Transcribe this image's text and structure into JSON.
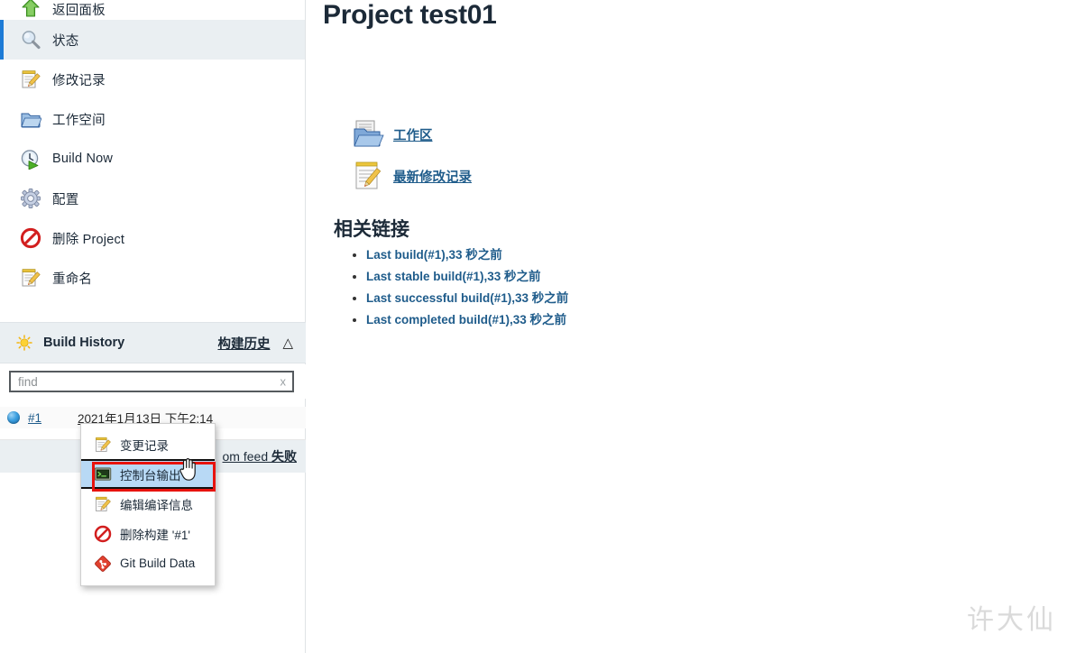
{
  "sidebar": {
    "tasks": [
      {
        "label": "返回面板",
        "icon": "up-arrow-icon",
        "active": false,
        "partial": true
      },
      {
        "label": "状态",
        "icon": "magnifier-icon",
        "active": true,
        "partial": false
      },
      {
        "label": "修改记录",
        "icon": "notepad-pencil-icon",
        "active": false,
        "partial": false
      },
      {
        "label": "工作空间",
        "icon": "folder-icon",
        "active": false,
        "partial": false
      },
      {
        "label": "Build Now",
        "icon": "build-clock-icon",
        "active": false,
        "partial": false
      },
      {
        "label": "配置",
        "icon": "gear-icon",
        "active": false,
        "partial": false
      },
      {
        "label": "删除 Project",
        "icon": "delete-forbidden-icon",
        "active": false,
        "partial": false
      },
      {
        "label": "重命名",
        "icon": "notepad-pencil-icon",
        "active": false,
        "partial": false
      }
    ],
    "build_history": {
      "title": "Build History",
      "link_label": "构建历史",
      "collapse_icon": "chevron-up-icon",
      "sun_icon": "weather-sun-icon",
      "find": {
        "value": "",
        "placeholder": "find",
        "clear_label": "x"
      },
      "rows": [
        {
          "status": "blue-ball-icon",
          "number": "#1",
          "date": "2021年1月13日 下午2:14"
        }
      ],
      "feed": {
        "prefix": "om feed ",
        "status": "失败"
      }
    }
  },
  "main": {
    "page_title": "Project test01",
    "quick_links": [
      {
        "label": "工作区",
        "icon": "workspace-folder-icon"
      },
      {
        "label": "最新修改记录",
        "icon": "changes-notepad-icon"
      }
    ],
    "related_heading": "相关链接",
    "related_links": [
      "Last build(#1),33 秒之前",
      "Last stable build(#1),33 秒之前",
      "Last successful build(#1),33 秒之前",
      "Last completed build(#1),33 秒之前"
    ],
    "watermark": "许大仙"
  },
  "context_menu": {
    "items": [
      {
        "label": "变更记录",
        "icon": "notepad-pencil-icon",
        "selected": false
      },
      {
        "label": "控制台输出",
        "icon": "console-terminal-icon",
        "selected": true
      },
      {
        "label": "编辑编译信息",
        "icon": "notepad-pencil-icon",
        "selected": false
      },
      {
        "label": "删除构建 '#1'",
        "icon": "delete-forbidden-icon",
        "selected": false
      },
      {
        "label": "Git Build Data",
        "icon": "git-diamond-icon",
        "selected": false
      }
    ],
    "highlight_color": "#e8130e",
    "selected_bg": "#b8d9f5"
  },
  "colors": {
    "accent_blue": "#1d7bd6",
    "link_blue": "#1f5c8b",
    "panel_bg": "#eaeff2",
    "text_dark": "#1c2a38"
  }
}
